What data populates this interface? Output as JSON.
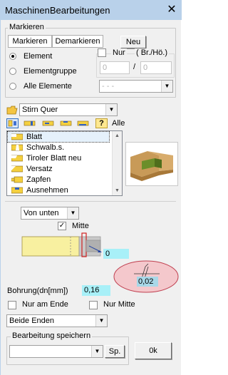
{
  "window": {
    "title": "MaschinenBearbeitungen",
    "close": "✕"
  },
  "markieren": {
    "group_title": "Markieren",
    "btn_markieren": "Markieren",
    "btn_demarkieren": "Demarkieren",
    "btn_neu": "Neu",
    "radio_element": "Element",
    "radio_elementgruppe": "Elementgruppe",
    "radio_alle": "Alle Elemente",
    "nur_label": "Nur",
    "br_ho_label": "( Br./Hö.)",
    "br_value": "0",
    "ho_value": "0",
    "slash": "/",
    "alle_combo_value": "- - -"
  },
  "type_combo": {
    "value": "Stirn Quer"
  },
  "toolbar": {
    "help": "?",
    "alle_label": "Alle"
  },
  "processing_list": {
    "items": [
      {
        "label": "Blatt",
        "selected": true
      },
      {
        "label": "Schwalb.s.",
        "selected": false
      },
      {
        "label": "Tiroler Blatt neu",
        "selected": false
      },
      {
        "label": "Versatz",
        "selected": false
      },
      {
        "label": "Zapfen",
        "selected": false
      },
      {
        "label": "Ausnehmen",
        "selected": false
      }
    ]
  },
  "details": {
    "direction_combo": "Von unten",
    "mitte_label": "Mitte",
    "mitte_checked": true,
    "offset_value": "0",
    "hole_value": "0,02",
    "bohrung_label": "Bohrung(dn[mm])",
    "bohrung_value": "0,16",
    "nur_am_ende": "Nur am Ende",
    "nur_mitte": "Nur Mitte",
    "ends_combo": "Beide Enden"
  },
  "speichern": {
    "group_title": "Bearbeitung speichern",
    "combo_value": "",
    "sp_button": "Sp.",
    "ok_button": "0k"
  },
  "colors": {
    "titlebar": "#b9d1ea",
    "cyan_field": "#a8f0f8",
    "ellipse_fill": "#f4c8cc",
    "ellipse_stroke": "#c04050"
  }
}
